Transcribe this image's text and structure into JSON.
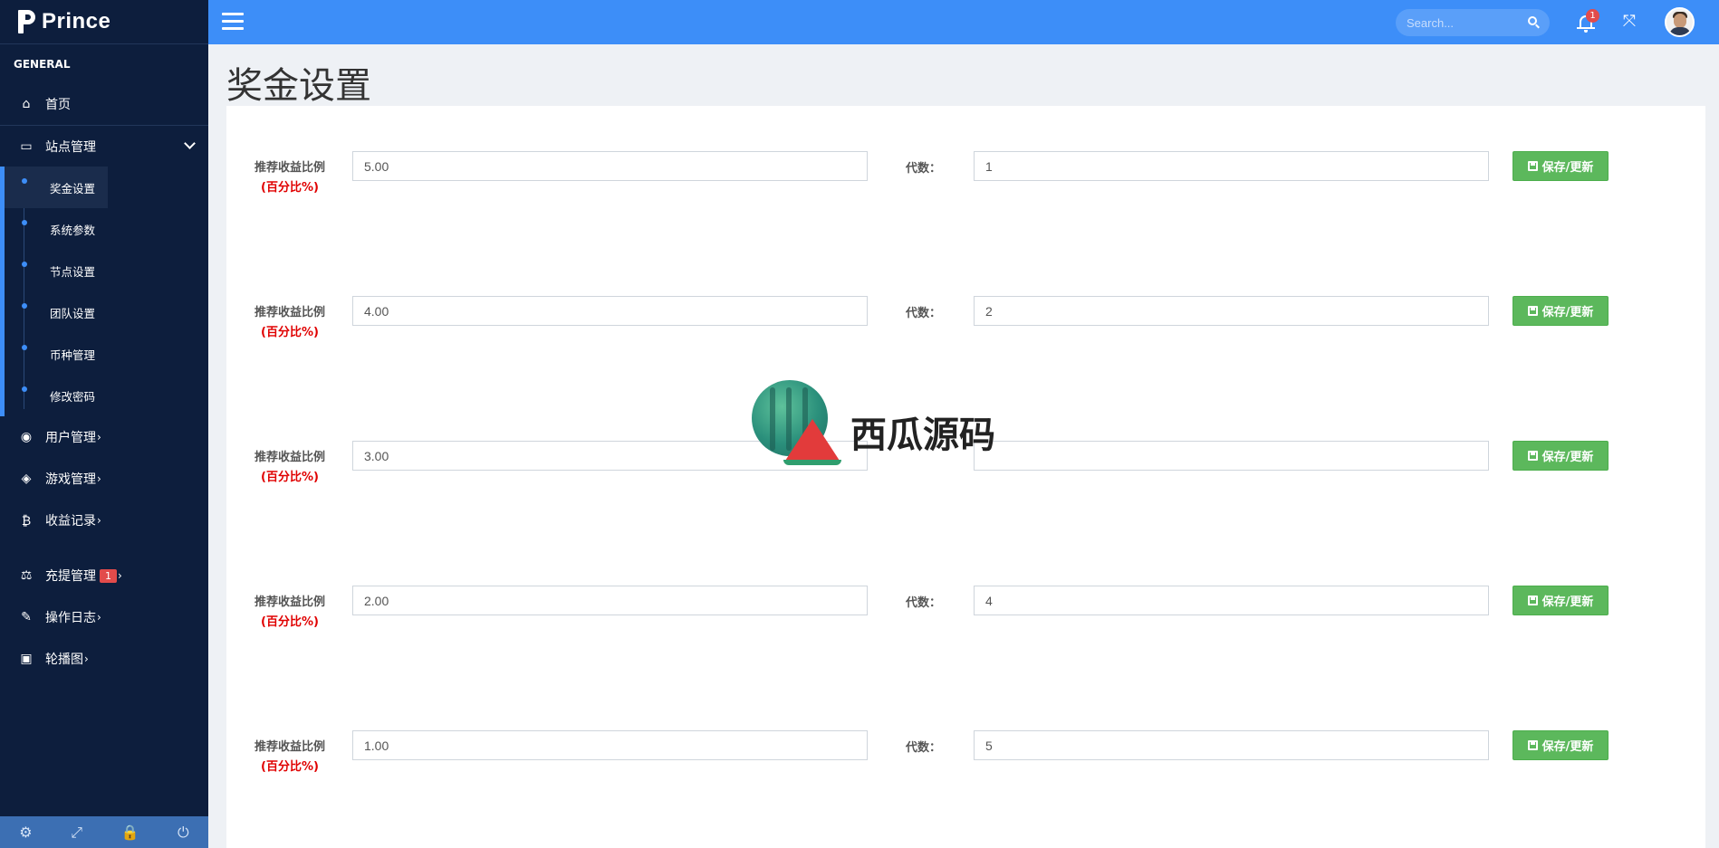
{
  "app": {
    "brand": "Prince"
  },
  "sidebar": {
    "section_title": "GENERAL",
    "home": "首页",
    "site_group": "站点管理",
    "sub_items": [
      "奖金设置",
      "系统参数",
      "节点设置",
      "团队设置",
      "币种管理",
      "修改密码"
    ],
    "user_mgmt": "用户管理",
    "game_mgmt": "游戏管理",
    "income_records": "收益记录",
    "recharge_mgmt": "充提管理",
    "recharge_badge": "1",
    "op_log": "操作日志",
    "carousel": "轮播图",
    "footer_icons": [
      "gear-icon",
      "expand-icon",
      "lock-icon",
      "power-icon"
    ]
  },
  "topbar": {
    "search_placeholder": "Search...",
    "notification_count": "1"
  },
  "main": {
    "page_title": "奖金设置",
    "ratio_label": "推荐收益比例",
    "percent_label": "(百分比%)",
    "generation_label": "代数：",
    "save_label": "保存/更新",
    "rows": [
      {
        "ratio": "5.00",
        "generation": "1"
      },
      {
        "ratio": "4.00",
        "generation": "2"
      },
      {
        "ratio": "3.00",
        "generation": ""
      },
      {
        "ratio": "2.00",
        "generation": "4"
      },
      {
        "ratio": "1.00",
        "generation": "5"
      }
    ]
  },
  "watermark": {
    "text": "西瓜源码"
  },
  "colors": {
    "sidebar_bg": "#0d1e3d",
    "topbar_bg": "#3d8ef8",
    "save_green": "#5cb85c",
    "percent_red": "#e00000",
    "badge_red": "#e24b4b"
  }
}
